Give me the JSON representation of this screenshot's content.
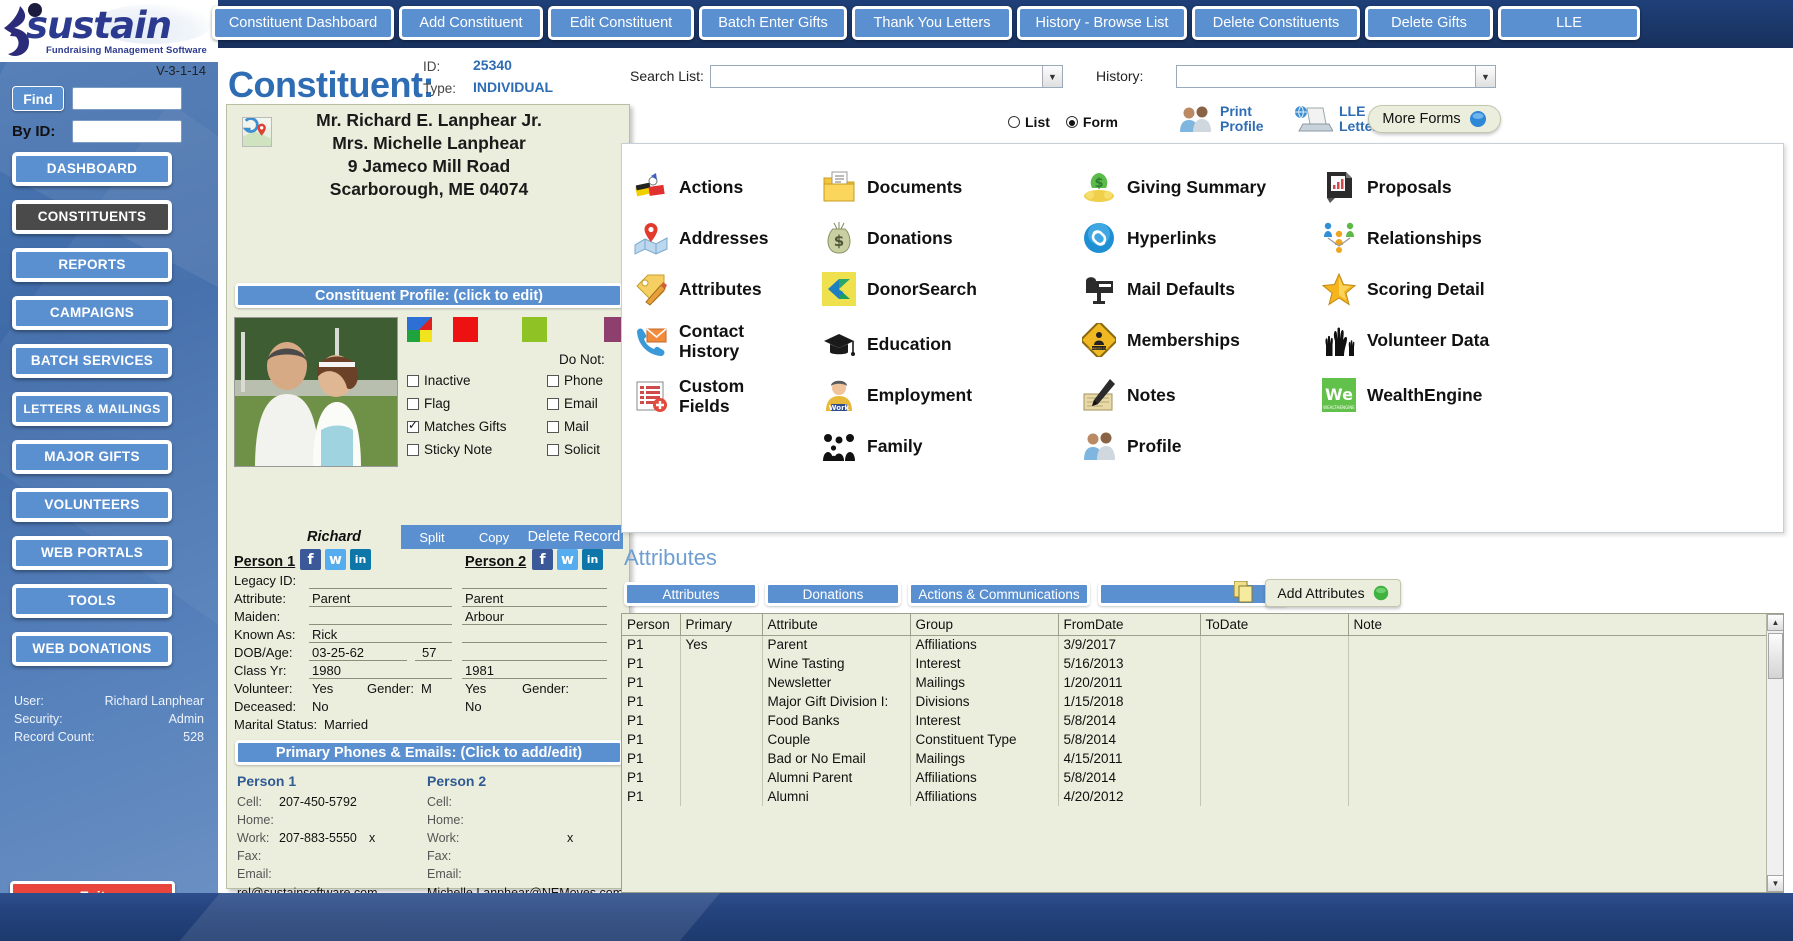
{
  "brand": {
    "name": "sustain",
    "tagline": "Fundraising Management Software",
    "version": "V-3-1-14"
  },
  "sidebar": {
    "find_label": "Find",
    "find_value": "",
    "byid_label": "By ID:",
    "byid_value": "",
    "items": [
      {
        "label": "DASHBOARD",
        "active": false
      },
      {
        "label": "CONSTITUENTS",
        "active": true
      },
      {
        "label": "REPORTS",
        "active": false
      },
      {
        "label": "CAMPAIGNS",
        "active": false
      },
      {
        "label": "BATCH SERVICES",
        "active": false
      },
      {
        "label": "LETTERS & MAILINGS",
        "active": false
      },
      {
        "label": "MAJOR GIFTS",
        "active": false
      },
      {
        "label": "VOLUNTEERS",
        "active": false
      },
      {
        "label": "WEB PORTALS",
        "active": false
      },
      {
        "label": "TOOLS",
        "active": false
      },
      {
        "label": "WEB DONATIONS",
        "active": false
      }
    ],
    "status": {
      "user_label": "User:",
      "user_value": "Richard Lanphear",
      "security_label": "Security:",
      "security_value": "Admin",
      "record_label": "Record Count:",
      "record_value": "528"
    },
    "exit_label": "Exit"
  },
  "topbar": {
    "buttons": [
      "Constituent Dashboard",
      "Add Constituent",
      "Edit Constituent",
      "Batch Enter Gifts",
      "Thank You Letters",
      "History - Browse List",
      "Delete Constituents",
      "Delete Gifts",
      "LLE"
    ]
  },
  "header": {
    "title": "Constituent:",
    "id_label": "ID:",
    "id_value": "25340",
    "type_label": "Type:",
    "type_value": "INDIVIDUAL",
    "search_list_label": "Search List:",
    "search_list_value": "",
    "history_label": "History:",
    "history_value": ""
  },
  "view_toggle": {
    "list_label": "List",
    "form_label": "Form",
    "selected": "Form"
  },
  "top_actions": {
    "print_profile": "Print\nProfile",
    "print_profile_line1": "Print",
    "print_profile_line2": "Profile",
    "lle_letter_line1": "LLE",
    "lle_letter_line2": "Letter",
    "more_forms": "More Forms"
  },
  "card": {
    "address_lines": [
      "Mr. Richard E. Lanphear Jr.",
      "Mrs. Michelle Lanphear",
      "9 Jameco Mill Road",
      "Scarborough, ME 04074"
    ],
    "profile_bar": "Constituent Profile:  (click to edit)",
    "checkboxes_left": [
      {
        "label": "Inactive",
        "checked": false
      },
      {
        "label": "Flag",
        "checked": false
      },
      {
        "label": "Matches Gifts",
        "checked": true
      },
      {
        "label": "Sticky Note",
        "checked": false
      }
    ],
    "donot_label": "Do Not:",
    "checkboxes_right": [
      {
        "label": "Phone",
        "checked": false
      },
      {
        "label": "Email",
        "checked": false
      },
      {
        "label": "Mail",
        "checked": false
      },
      {
        "label": "Solicit",
        "checked": false
      }
    ],
    "photo_caption": "Richard",
    "action_bar": {
      "split": "Split",
      "copy": "Copy",
      "delete": "Delete Record"
    },
    "person1_label": "Person 1",
    "person2_label": "Person 2",
    "fields": [
      {
        "label": "Legacy ID:",
        "p1": "",
        "p2": ""
      },
      {
        "label": "Attribute:",
        "p1": "Parent",
        "p2": "Parent"
      },
      {
        "label": "Maiden:",
        "p1": "",
        "p2": "Arbour"
      },
      {
        "label": "Known As:",
        "p1": "Rick",
        "p2": ""
      },
      {
        "label": "DOB/Age:",
        "p1": "03-25-62",
        "p1b": "57",
        "p2": "",
        "p2b": ""
      },
      {
        "label": "Class Yr:",
        "p1": "1980",
        "p2": "1981"
      },
      {
        "label": "Volunteer:",
        "p1": "Yes",
        "gender_label": "Gender:",
        "p1_gender": "M",
        "p2": "Yes",
        "p2_gender_label": "Gender:",
        "p2_gender": ""
      },
      {
        "label": "Deceased:",
        "p1": "No",
        "p2": "No"
      },
      {
        "label": "Marital Status:",
        "p1": "Married",
        "p2": ""
      }
    ],
    "phones_bar": "Primary Phones & Emails:  (Click to add/edit)",
    "phones": {
      "person1_label": "Person 1",
      "person2_label": "Person 2",
      "rows": [
        {
          "label": "Cell:",
          "p1": "207-450-5792",
          "p1x": "",
          "p2": "",
          "p2x": ""
        },
        {
          "label": "Home:",
          "p1": "",
          "p1x": "",
          "p2": "",
          "p2x": ""
        },
        {
          "label": "Work:",
          "p1": "207-883-5550",
          "p1x": "x",
          "p2": "",
          "p2x": "x"
        },
        {
          "label": "Fax:",
          "p1": "",
          "p1x": "",
          "p2": "",
          "p2x": ""
        },
        {
          "label": "Email:",
          "p1": "",
          "p1x": "",
          "p2": "",
          "p2x": ""
        }
      ],
      "email1": "rel@sustainsoftware.com",
      "email2": "Michelle.Lanphear@NEMoves.com"
    }
  },
  "icon_panel": {
    "col1": [
      {
        "label": "Actions",
        "icon": "actions-icon"
      },
      {
        "label": "Addresses",
        "icon": "addresses-map-icon"
      },
      {
        "label": "Attributes",
        "icon": "attributes-tag-pencil-icon"
      },
      {
        "label": "Contact History",
        "icon": "contact-history-phone-envelope-icon"
      },
      {
        "label": "Custom Fields",
        "icon": "custom-fields-icon"
      }
    ],
    "col2": [
      {
        "label": "Documents",
        "icon": "documents-folder-icon"
      },
      {
        "label": "Donations",
        "icon": "donations-money-bag-icon"
      },
      {
        "label": "DonorSearch",
        "icon": "donorsearch-icon"
      },
      {
        "label": "Education",
        "icon": "education-graduation-cap-icon"
      },
      {
        "label": "Employment",
        "icon": "employment-worker-icon"
      },
      {
        "label": "Family",
        "icon": "family-group-icon"
      }
    ],
    "col3": [
      {
        "label": "Giving Summary",
        "icon": "giving-summary-money-icon"
      },
      {
        "label": "Hyperlinks",
        "icon": "hyperlinks-link-icon"
      },
      {
        "label": "Mail Defaults",
        "icon": "mail-defaults-mailbox-icon"
      },
      {
        "label": "Memberships",
        "icon": "memberships-sign-icon"
      },
      {
        "label": "Notes",
        "icon": "notes-pen-icon"
      },
      {
        "label": "Profile",
        "icon": "profile-people-icon"
      }
    ],
    "col4": [
      {
        "label": "Proposals",
        "icon": "proposals-report-icon"
      },
      {
        "label": "Relationships",
        "icon": "relationships-people-icon"
      },
      {
        "label": "Scoring Detail",
        "icon": "scoring-detail-star-icon"
      },
      {
        "label": "Volunteer Data",
        "icon": "volunteer-data-hands-icon"
      },
      {
        "label": "WealthEngine",
        "icon": "wealthengine-icon"
      }
    ]
  },
  "attributes_section": {
    "title": "Attributes",
    "tabs": [
      "Attributes",
      "Donations",
      "Actions & Communications"
    ],
    "dropdown_value": "",
    "add_button": "Add Attributes",
    "columns": [
      "Person",
      "Primary",
      "Attribute",
      "Group",
      "FromDate",
      "ToDate",
      "Note"
    ],
    "rows": [
      [
        "P1",
        "Yes",
        "Parent",
        "Affiliations",
        "3/9/2017",
        "",
        ""
      ],
      [
        "P1",
        "",
        "Wine Tasting",
        "Interest",
        "5/16/2013",
        "",
        ""
      ],
      [
        "P1",
        "",
        "Newsletter",
        "Mailings",
        "1/20/2011",
        "",
        ""
      ],
      [
        "P1",
        "",
        "Major Gift Division I:",
        "Divisions",
        "1/15/2018",
        "",
        ""
      ],
      [
        "P1",
        "",
        "Food Banks",
        "Interest",
        "5/8/2014",
        "",
        ""
      ],
      [
        "P1",
        "",
        "Couple",
        "Constituent Type",
        "5/8/2014",
        "",
        ""
      ],
      [
        "P1",
        "",
        "Bad or No Email",
        "Mailings",
        "4/15/2011",
        "",
        ""
      ],
      [
        "P1",
        "",
        "Alumni Parent",
        "Affiliations",
        "5/8/2014",
        "",
        ""
      ],
      [
        "P1",
        "",
        "Alumni",
        "Affiliations",
        "4/20/2012",
        "",
        ""
      ]
    ]
  },
  "colors": {
    "accent_blue": "#5b90d0",
    "title_blue": "#2e6db4",
    "panel_cream": "#eceedd",
    "topbar_navy": "#1b3768",
    "exit_red": "#e8453c",
    "swatch_red": "#ee1111",
    "swatch_green": "#8fc325",
    "swatch_purple": "#8e3f6e"
  }
}
